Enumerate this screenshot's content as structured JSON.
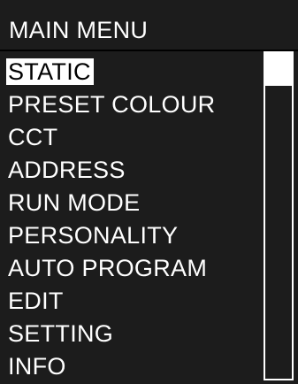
{
  "header": {
    "title": "MAIN MENU"
  },
  "menu": {
    "items": [
      {
        "label": "STATIC",
        "selected": true
      },
      {
        "label": "PRESET COLOUR",
        "selected": false
      },
      {
        "label": "CCT",
        "selected": false
      },
      {
        "label": "ADDRESS",
        "selected": false
      },
      {
        "label": "RUN MODE",
        "selected": false
      },
      {
        "label": "PERSONALITY",
        "selected": false
      },
      {
        "label": "AUTO PROGRAM",
        "selected": false
      },
      {
        "label": "EDIT",
        "selected": false
      },
      {
        "label": "SETTING",
        "selected": false
      },
      {
        "label": "INFO",
        "selected": false
      }
    ]
  },
  "scrollbar": {
    "position_fraction": 0.0,
    "visible_fraction": 0.1
  },
  "colors": {
    "background": "#1c1c1c",
    "foreground": "#ffffff",
    "highlight_text": "#000000"
  }
}
